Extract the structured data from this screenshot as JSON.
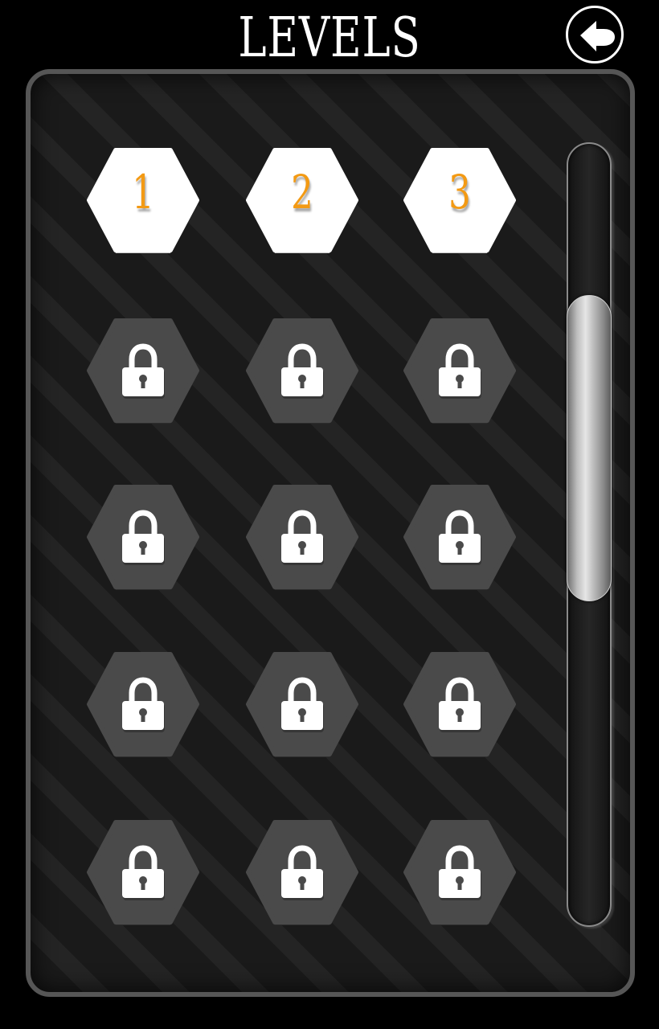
{
  "header": {
    "title": "LEVELS",
    "back_button": {
      "icon": "arrow-left-icon"
    }
  },
  "colors": {
    "background": "#000000",
    "panel_border": "#565656",
    "unlocked_tile": "#ffffff",
    "locked_tile": "#4a4a4a",
    "level_number": "#f39a14",
    "lock_icon": "#ffffff"
  },
  "levels": [
    {
      "label": "1",
      "locked": false
    },
    {
      "label": "2",
      "locked": false
    },
    {
      "label": "3",
      "locked": false
    },
    {
      "label": "",
      "locked": true,
      "icon": "lock-icon"
    },
    {
      "label": "",
      "locked": true,
      "icon": "lock-icon"
    },
    {
      "label": "",
      "locked": true,
      "icon": "lock-icon"
    },
    {
      "label": "",
      "locked": true,
      "icon": "lock-icon"
    },
    {
      "label": "",
      "locked": true,
      "icon": "lock-icon"
    },
    {
      "label": "",
      "locked": true,
      "icon": "lock-icon"
    },
    {
      "label": "",
      "locked": true,
      "icon": "lock-icon"
    },
    {
      "label": "",
      "locked": true,
      "icon": "lock-icon"
    },
    {
      "label": "",
      "locked": true,
      "icon": "lock-icon"
    },
    {
      "label": "",
      "locked": true,
      "icon": "lock-icon"
    },
    {
      "label": "",
      "locked": true,
      "icon": "lock-icon"
    },
    {
      "label": "",
      "locked": true,
      "icon": "lock-icon"
    }
  ],
  "scrollbar": {
    "thumb_fraction": 0.39,
    "scroll_position": 0.32
  }
}
